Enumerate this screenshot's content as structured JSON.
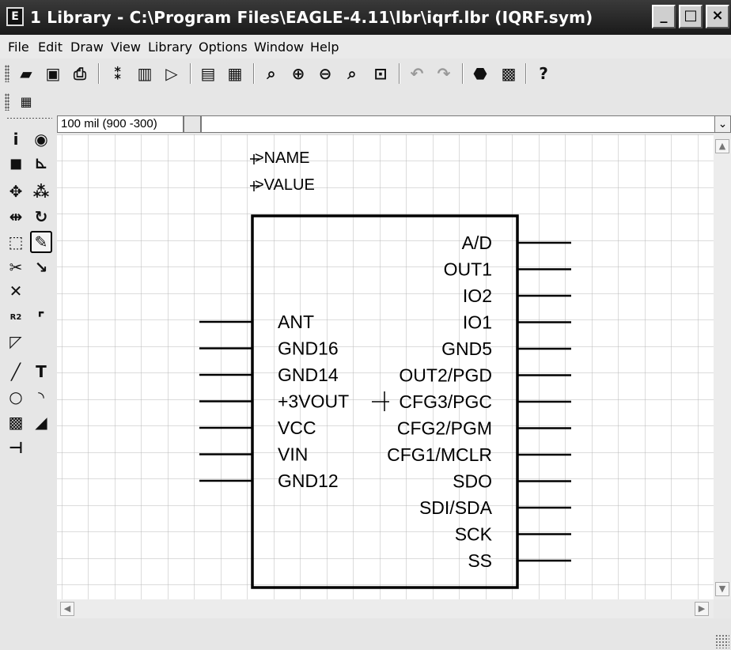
{
  "window": {
    "title": "1 Library - C:\\Program Files\\EAGLE-4.11\\lbr\\iqrf.lbr (IQRF.sym)",
    "app_icon": "eagle-app-icon",
    "controls": [
      "minimize",
      "maximize",
      "close"
    ]
  },
  "menu": [
    {
      "label": "File"
    },
    {
      "label": "Edit"
    },
    {
      "label": "Draw"
    },
    {
      "label": "View"
    },
    {
      "label": "Library"
    },
    {
      "label": "Options"
    },
    {
      "label": "Window"
    },
    {
      "label": "Help"
    }
  ],
  "toolbar_icons": [
    "open-icon",
    "save-icon",
    "print-icon",
    "board-icon",
    "package-icon",
    "symbol-icon",
    "script-icon",
    "ulp-icon",
    "zoom-fit-icon",
    "zoom-in-icon",
    "zoom-out-icon",
    "redraw-icon",
    "zoom-select-icon",
    "undo-icon",
    "redo-icon",
    "stop-icon",
    "go-icon",
    "help-icon"
  ],
  "command_row": {
    "coordinates": "100 mil (900 -300)",
    "command_value": ""
  },
  "palette_icons": [
    "info-icon",
    "show-icon",
    "display-icon",
    "mark-icon",
    "move-icon",
    "copy-icon",
    "mirror-icon",
    "rotate-icon",
    "group-icon",
    "change-icon",
    "cut-icon",
    "paste-icon",
    "delete-icon",
    "name-icon",
    "value-icon",
    "smash-icon",
    "miter-icon",
    "split-icon",
    "wire-icon",
    "text-icon",
    "circle-icon",
    "arc-icon",
    "rect-icon",
    "polygon-icon",
    "pin-icon"
  ],
  "symbol": {
    "name_label": ">NAME",
    "value_label": ">VALUE",
    "left_pins": [
      "ANT",
      "GND16",
      "GND14",
      "+3VOUT",
      "VCC",
      "VIN",
      "GND12"
    ],
    "right_pins": [
      "A/D",
      "OUT1",
      "IO2",
      "IO1",
      "GND5",
      "OUT2/PGD",
      "CFG3/PGC",
      "CFG2/PGM",
      "CFG1/MCLR",
      "SDO",
      "SDI/SDA",
      "SCK",
      "SS"
    ]
  },
  "colors": {
    "grid": "#b8b8b8",
    "background": "#ffffff",
    "symbol": "#000000",
    "titlebar": "#2a2a2a"
  }
}
